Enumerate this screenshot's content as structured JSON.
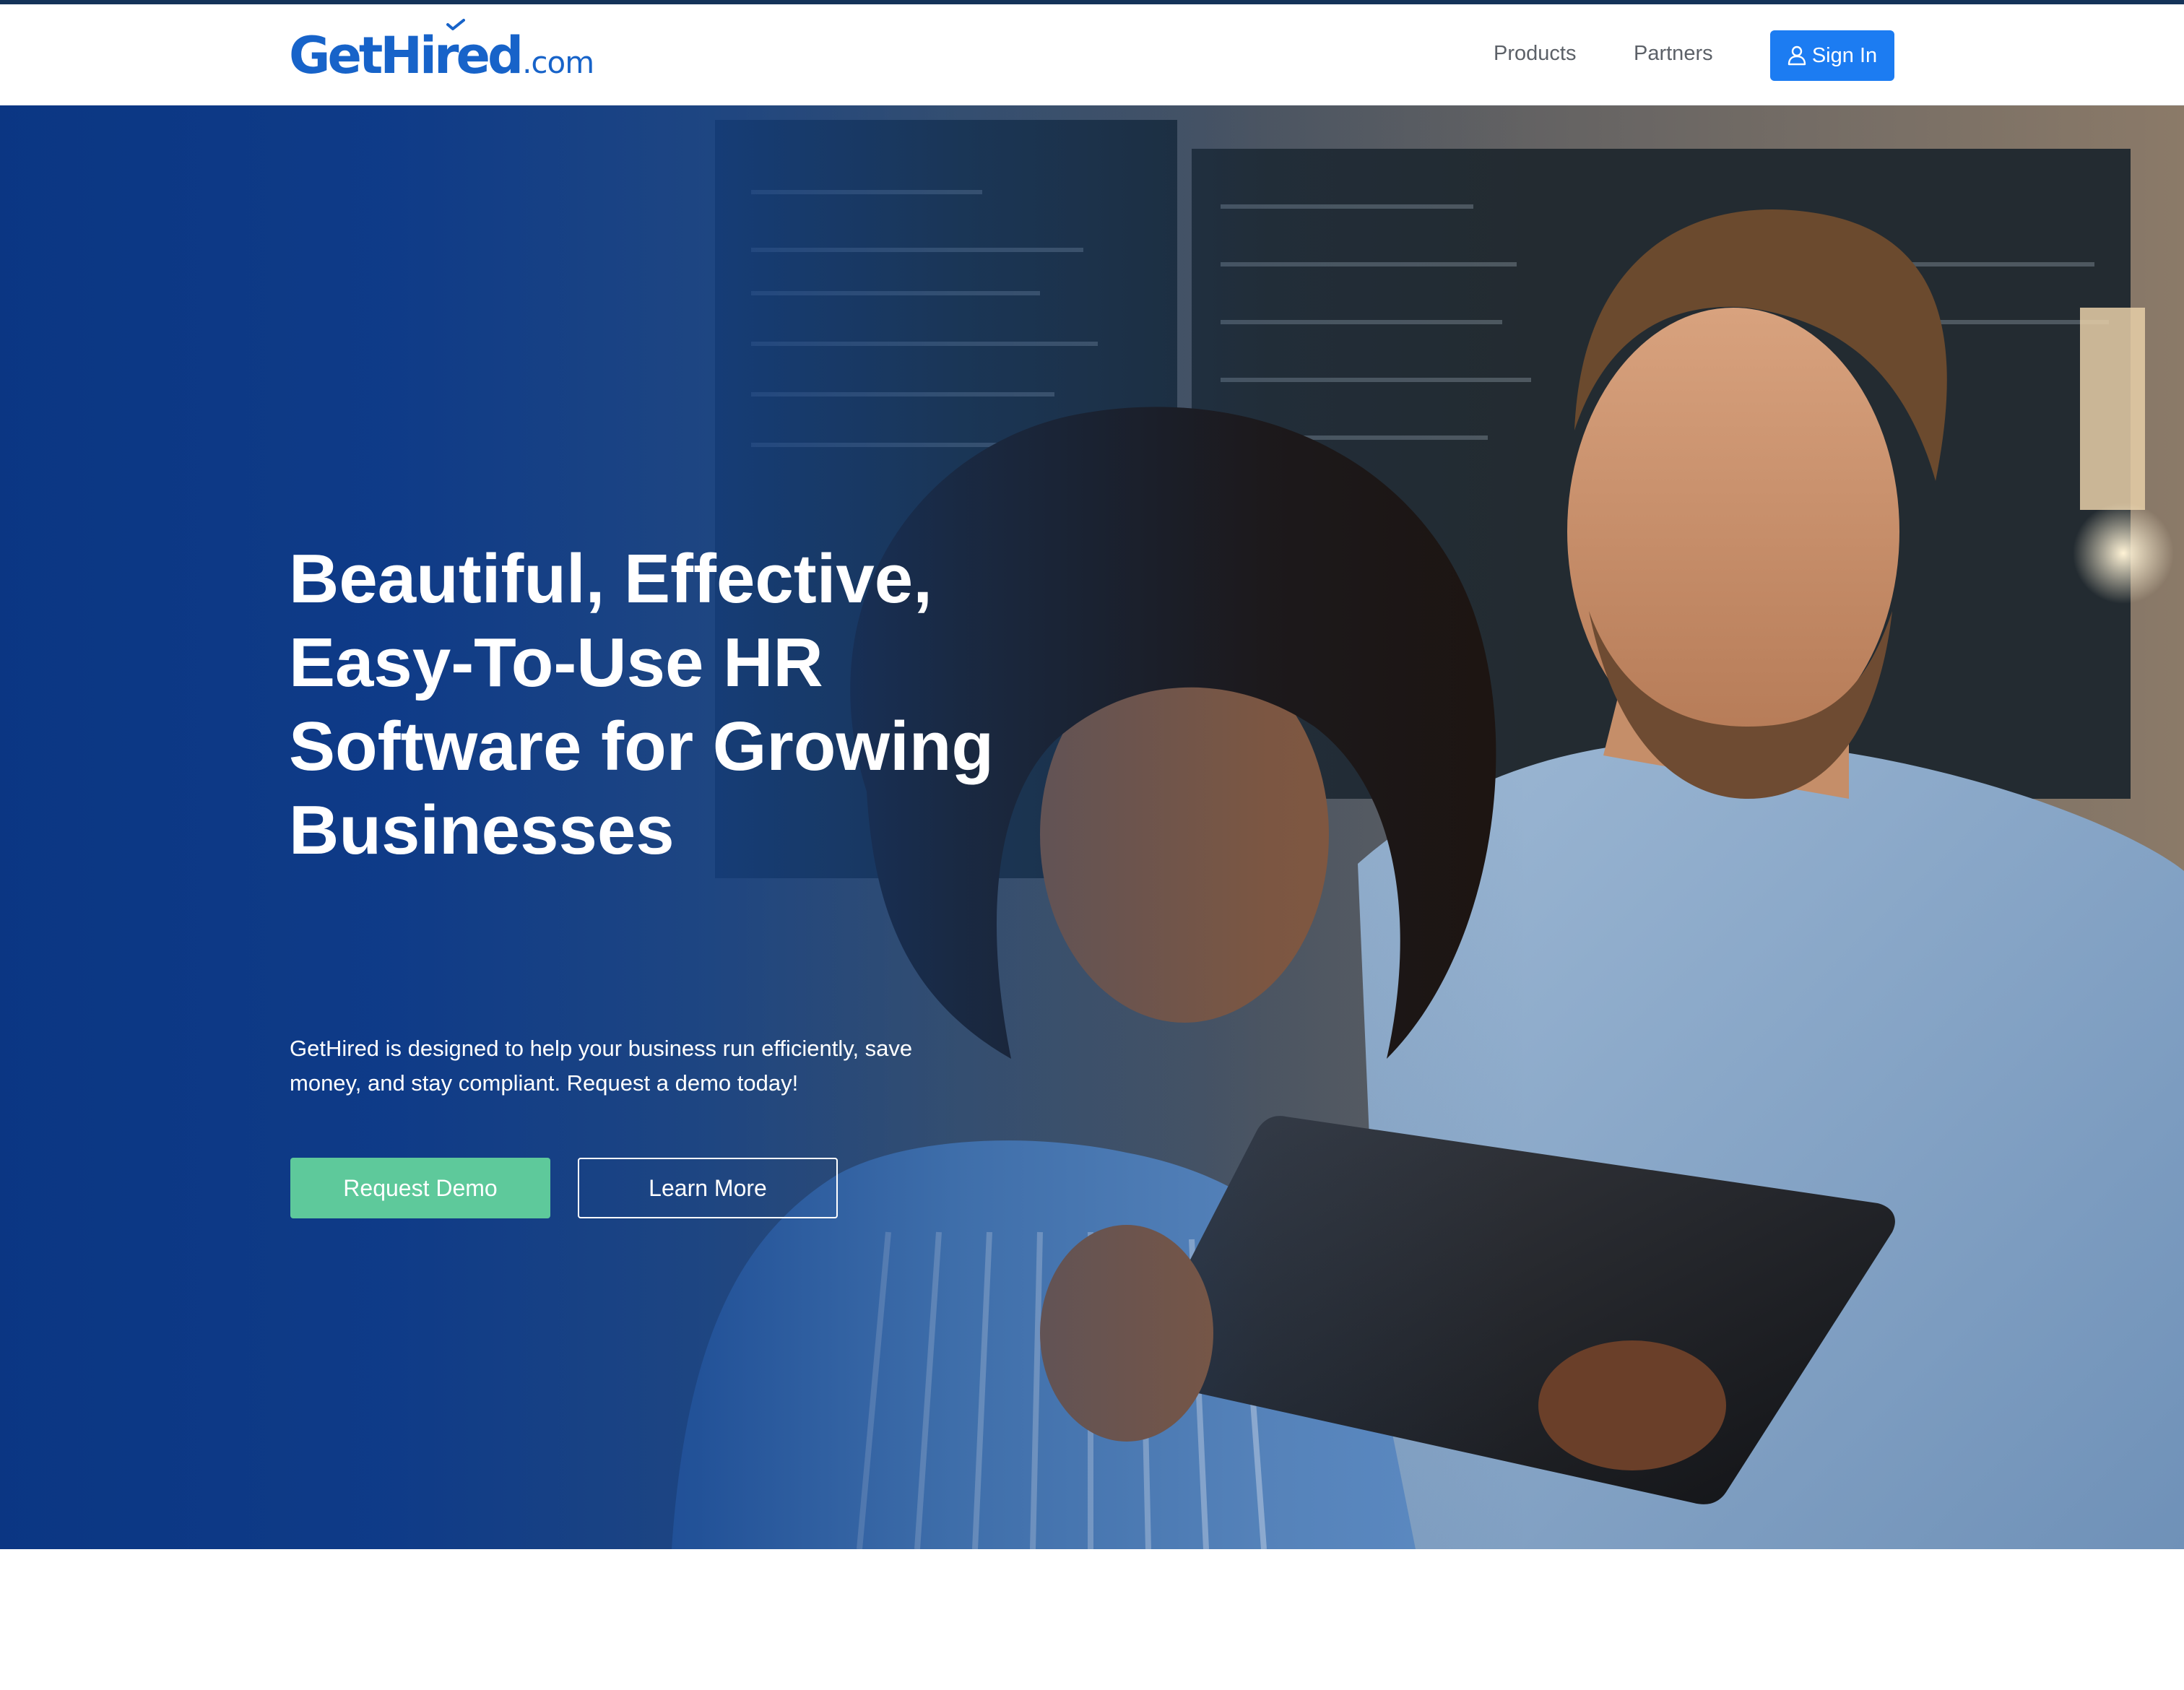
{
  "header": {
    "logo_main": "GetHired",
    "logo_tld": ".com",
    "nav": [
      {
        "label": "Products"
      },
      {
        "label": "Partners"
      }
    ],
    "signin_label": "Sign In",
    "signin_icon": "user-icon"
  },
  "hero": {
    "title": "Beautiful, Effective, Easy-To-Use HR Software for Growing Businesses",
    "subtitle": "GetHired is designed to help your business run efficiently, save money, and stay compliant. Request a demo today!",
    "primary_cta": "Request Demo",
    "secondary_cta": "Learn More"
  },
  "colors": {
    "brand_blue": "#1763c9",
    "signin_blue": "#1c7cf2",
    "hero_blue": "#0a3684",
    "cta_green": "#5ec99b",
    "top_rule": "#143359"
  }
}
